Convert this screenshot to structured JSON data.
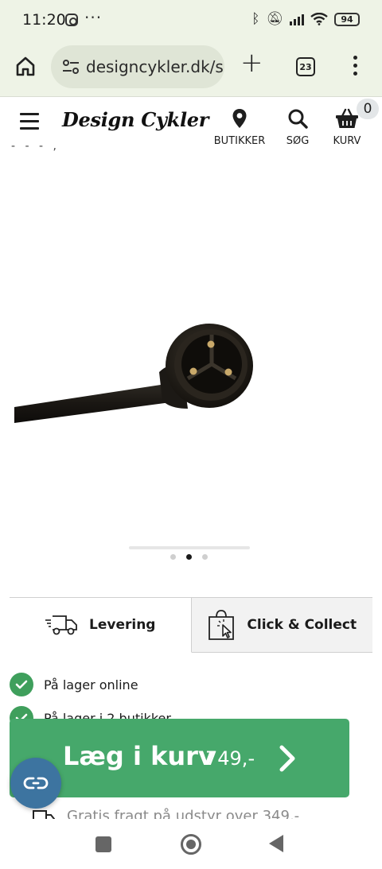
{
  "status_bar": {
    "time": "11:20",
    "more": "···",
    "battery": "94"
  },
  "browser": {
    "url": "designcykler.dk/s",
    "tab_count": "23"
  },
  "header": {
    "logo": "Design Cykler",
    "stores_label": "BUTIKKER",
    "search_label": "SØG",
    "cart_label": "KURV",
    "cart_count": "0"
  },
  "gallery": {
    "slide_count": 3,
    "active_slide": 2
  },
  "delivery_tabs": [
    {
      "label": "Levering",
      "icon": "truck-icon"
    },
    {
      "label": "Click & Collect",
      "icon": "shopping-bag-icon"
    }
  ],
  "stock": {
    "online": "På lager online",
    "stores": "På lager i 2 butikker"
  },
  "shipping_note": "Gratis fragt på udstyr over 349,-",
  "add_to_cart": {
    "label": "Læg i kurv",
    "price": "749,-"
  },
  "colors": {
    "accent_green": "#46a86b",
    "check_green": "#3f9f5c",
    "chat_blue": "#3d74a0"
  }
}
